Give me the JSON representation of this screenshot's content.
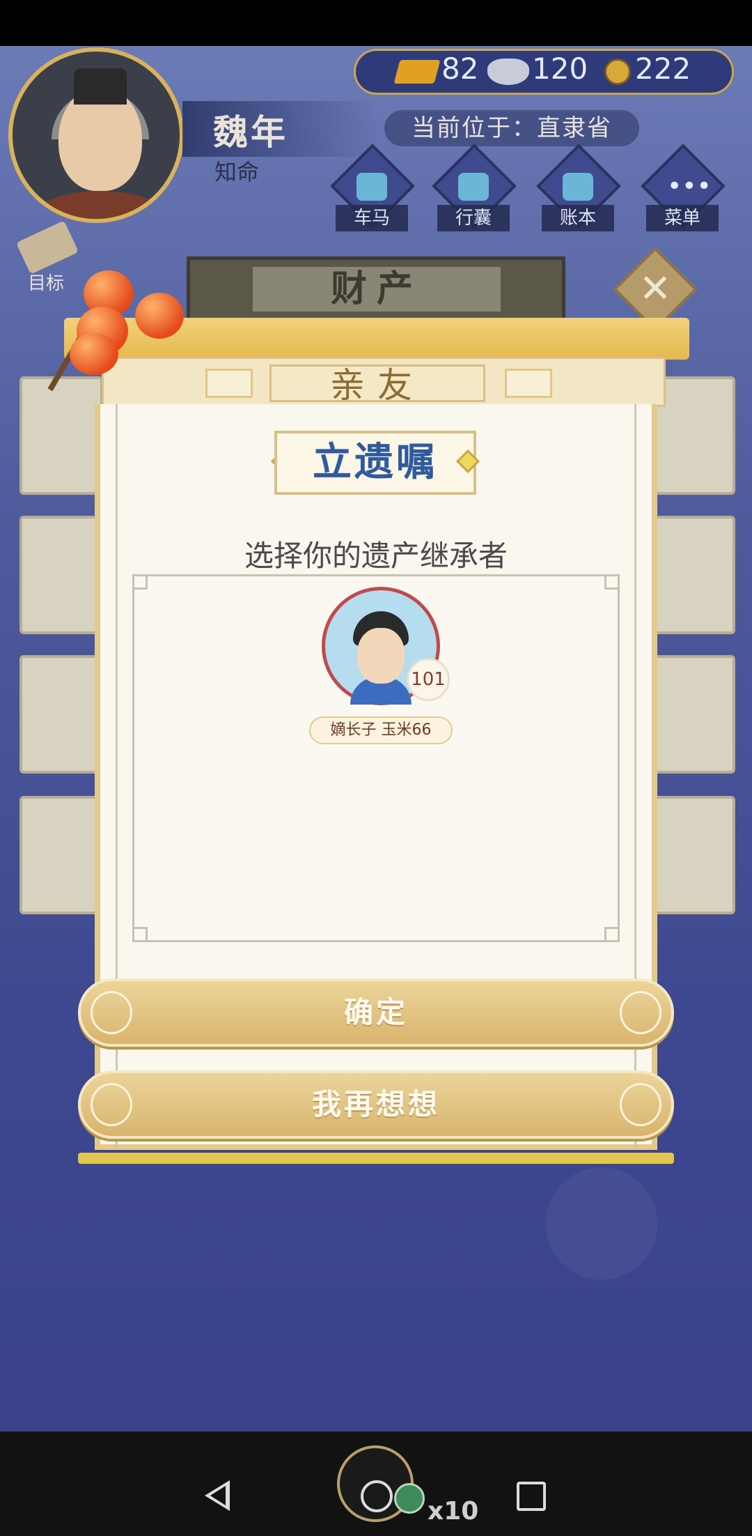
{
  "player": {
    "name": "魏年",
    "age_label": "知命"
  },
  "currency": {
    "gold": "82",
    "silver": "120",
    "coins": "222"
  },
  "location": {
    "text": "当前位于：直隶省"
  },
  "top_menu": {
    "items": [
      {
        "label": "车马",
        "icon": "carriage-icon"
      },
      {
        "label": "行囊",
        "icon": "bag-icon"
      },
      {
        "label": "账本",
        "icon": "ledger-icon"
      },
      {
        "label": "菜单",
        "icon": "more-icon"
      }
    ]
  },
  "goal": {
    "label": "目标"
  },
  "property_panel": {
    "title": "财产"
  },
  "tabs": {
    "active": "亲友"
  },
  "dialog": {
    "title": "立遗嘱",
    "subtitle": "选择你的遗产继承者",
    "heir": {
      "level": "101",
      "tag": "嫡长子 玉米66"
    },
    "confirm_label": "确定",
    "cancel_label": "我再想想"
  },
  "floating_reward": {
    "count": "x10"
  }
}
